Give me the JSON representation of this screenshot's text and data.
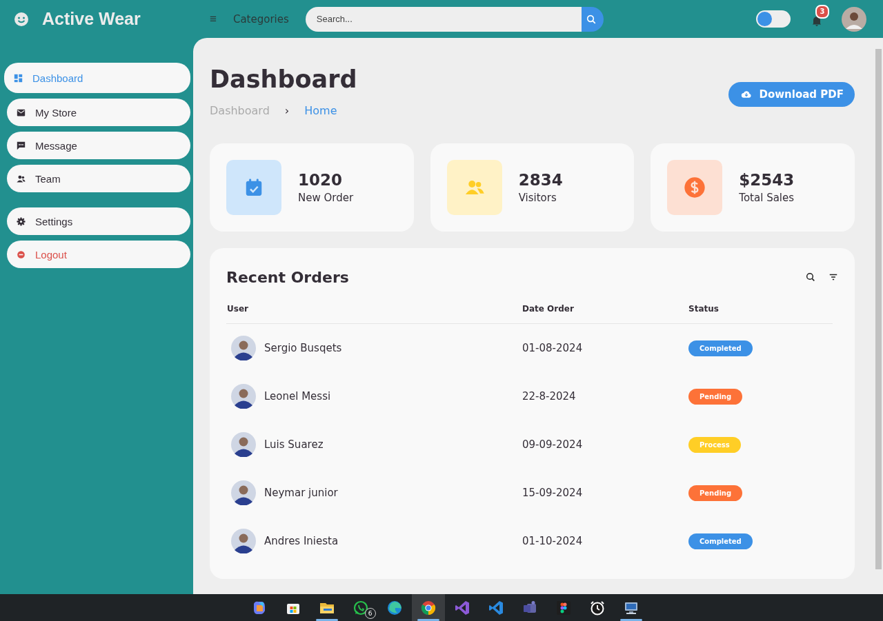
{
  "brand": {
    "name": "Active Wear"
  },
  "topbar": {
    "menu_glyph": "≡",
    "categories": "Categories",
    "search": {
      "placeholder": "Search..."
    },
    "toggle": {
      "on": false
    },
    "notifications": {
      "count": "3"
    }
  },
  "sidebar": {
    "items": [
      {
        "label": "Dashboard",
        "selected": true,
        "danger": false
      },
      {
        "label": "My Store",
        "selected": false,
        "danger": false
      },
      {
        "label": "Message",
        "selected": false,
        "danger": false
      },
      {
        "label": "Team",
        "selected": false,
        "danger": false
      },
      {
        "label": "Settings",
        "selected": false,
        "danger": false
      },
      {
        "label": "Logout",
        "selected": false,
        "danger": true
      }
    ]
  },
  "header": {
    "title": "Dashboard",
    "breadcrumb": [
      {
        "label": "Dashboard",
        "selected": false
      },
      {
        "label": "Home",
        "selected": true
      }
    ],
    "separator": "›",
    "download_button": "Download PDF"
  },
  "stats": [
    {
      "value": "1020",
      "label": "New Order",
      "color": "#cfe6fb"
    },
    {
      "value": "2834",
      "label": "Visitors",
      "color": "#fff2c6"
    },
    {
      "value": "$2543",
      "label": "Total Sales",
      "color": "#fde0d3"
    }
  ],
  "orders": {
    "title": "Recent Orders",
    "columns": [
      "User",
      "Date Order",
      "Status"
    ],
    "rows": [
      {
        "user": "Sergio Busqets",
        "date": "01-08-2024",
        "status": "Completed",
        "color": "#3c91e6"
      },
      {
        "user": "Leonel Messi",
        "date": "22-8-2024",
        "status": "Pending",
        "color": "#fd7238"
      },
      {
        "user": "Luis Suarez",
        "date": "09-09-2024",
        "status": "Process",
        "color": "#ffce26"
      },
      {
        "user": "Neymar junior",
        "date": "15-09-2024",
        "status": "Pending",
        "color": "#fd7238"
      },
      {
        "user": "Andres Iniesta",
        "date": "01-10-2024",
        "status": "Completed",
        "color": "#3c91e6"
      }
    ]
  },
  "taskbar": {
    "apps": [
      {
        "kind": "copilot",
        "selected": false,
        "running": false
      },
      {
        "kind": "store",
        "selected": false,
        "running": false
      },
      {
        "kind": "folder",
        "selected": false,
        "running": true
      },
      {
        "kind": "chat",
        "selected": false,
        "running": false,
        "badge": "6"
      },
      {
        "kind": "edge",
        "selected": false,
        "running": false
      },
      {
        "kind": "chrome",
        "selected": true,
        "running": true
      },
      {
        "kind": "vs",
        "selected": false,
        "running": false
      },
      {
        "kind": "vscode",
        "selected": false,
        "running": false
      },
      {
        "kind": "teams",
        "selected": false,
        "running": false
      },
      {
        "kind": "figma",
        "selected": false,
        "running": false
      },
      {
        "kind": "clock",
        "selected": false,
        "running": false
      },
      {
        "kind": "remote",
        "selected": false,
        "running": true
      }
    ]
  }
}
